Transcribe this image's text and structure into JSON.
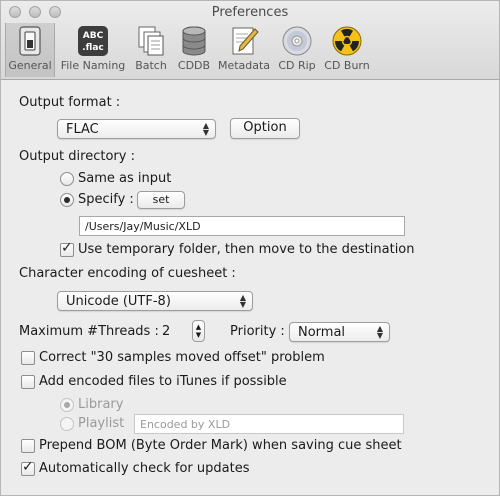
{
  "window": {
    "title": "Preferences"
  },
  "toolbar": [
    {
      "label": "General",
      "icon": "switch-icon",
      "selected": true
    },
    {
      "label": "File Naming",
      "icon": "abc-flac-icon",
      "icon_text": "ABC .flac"
    },
    {
      "label": "Batch",
      "icon": "documents-icon"
    },
    {
      "label": "CDDB",
      "icon": "database-icon"
    },
    {
      "label": "Metadata",
      "icon": "pencil-document-icon"
    },
    {
      "label": "CD Rip",
      "icon": "disc-icon"
    },
    {
      "label": "CD Burn",
      "icon": "radiation-icon"
    }
  ],
  "output_format": {
    "label": "Output format :",
    "selected": "FLAC",
    "option_button": "Option"
  },
  "output_directory": {
    "label": "Output directory :",
    "same_as_input": "Same as input",
    "specify": "Specify :",
    "set_button": "set",
    "path": "/Users/Jay/Music/XLD",
    "use_temp": "Use temporary folder, then move to the destination"
  },
  "cuesheet": {
    "label": "Character encoding of cuesheet :",
    "selected": "Unicode (UTF-8)"
  },
  "threads": {
    "label": "Maximum #Threads :",
    "value": "2",
    "priority_label": "Priority :",
    "priority": "Normal"
  },
  "options": {
    "correct_offset": "Correct \"30 samples moved offset\" problem",
    "add_itunes": "Add encoded files to iTunes if possible",
    "library": "Library",
    "playlist": "Playlist",
    "playlist_placeholder": "Encoded by XLD",
    "prepend_bom": "Prepend BOM (Byte Order Mark) when saving cue sheet",
    "auto_update": "Automatically check for updates"
  }
}
